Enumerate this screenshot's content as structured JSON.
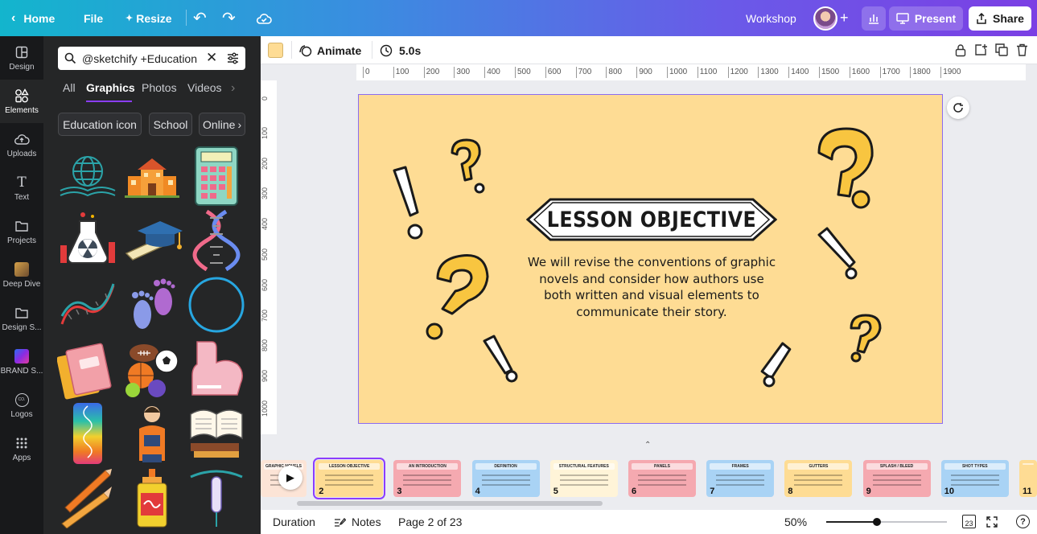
{
  "topbar": {
    "home_label": "Home",
    "file_label": "File",
    "resize_label": "Resize",
    "title": "Workshop",
    "present_label": "Present",
    "share_label": "Share"
  },
  "rail": {
    "items": [
      {
        "label": "Design",
        "icon": "layout-icon"
      },
      {
        "label": "Elements",
        "icon": "shapes-icon"
      },
      {
        "label": "Uploads",
        "icon": "cloud-upload-icon"
      },
      {
        "label": "Text",
        "icon": "text-icon"
      },
      {
        "label": "Projects",
        "icon": "folder-icon"
      },
      {
        "label": "Deep Dive",
        "icon": "app-thumbnail-icon"
      },
      {
        "label": "Design S...",
        "icon": "folder-icon"
      },
      {
        "label": "BRAND S...",
        "icon": "brand-gradient-icon"
      },
      {
        "label": "Logos",
        "icon": "logo-badge-icon"
      },
      {
        "label": "Apps",
        "icon": "apps-grid-icon"
      }
    ]
  },
  "panel": {
    "search_value": "@sketchify +Education",
    "tabs": [
      "All",
      "Graphics",
      "Photos",
      "Videos"
    ],
    "active_tab": "Graphics",
    "chips": [
      "Education icon",
      "School",
      "Online"
    ]
  },
  "toolbar": {
    "color": "#fedc94",
    "animate_label": "Animate",
    "duration_label": "5.0s"
  },
  "rulers": {
    "h": [
      "0",
      "100",
      "200",
      "300",
      "400",
      "500",
      "600",
      "700",
      "800",
      "900",
      "1000",
      "1100",
      "1200",
      "1300",
      "1400",
      "1500",
      "1600",
      "1700",
      "1800",
      "1900"
    ],
    "v": [
      "0",
      "100",
      "200",
      "300",
      "400",
      "500",
      "600",
      "700",
      "800",
      "900",
      "1000"
    ]
  },
  "slide": {
    "background": "#fedc94",
    "title": "LESSON OBJECTIVE",
    "body_lines": [
      "We will revise the conventions of graphic",
      "novels and consider how authors use",
      "both written and visual elements to",
      "communicate their story."
    ]
  },
  "filmstrip": {
    "pages": [
      {
        "n": "",
        "label": "GRAPHIC NOVELS",
        "color": "#fce4d6"
      },
      {
        "n": "2",
        "label": "LESSON OBJECTIVE",
        "color": "#fedc94"
      },
      {
        "n": "3",
        "label": "AN INTRODUCTION",
        "color": "#f5a9b0"
      },
      {
        "n": "4",
        "label": "DEFINITION",
        "color": "#a9d3f5"
      },
      {
        "n": "5",
        "label": "STRUCTURAL FEATURES",
        "color": "#fff4d8"
      },
      {
        "n": "6",
        "label": "PANELS",
        "color": "#f5a9b0"
      },
      {
        "n": "7",
        "label": "FRAMES",
        "color": "#a9d3f5"
      },
      {
        "n": "8",
        "label": "GUTTERS",
        "color": "#fedc94"
      },
      {
        "n": "9",
        "label": "SPLASH / BLEED",
        "color": "#f5a9b0"
      },
      {
        "n": "10",
        "label": "SHOT TYPES",
        "color": "#a9d3f5"
      },
      {
        "n": "11",
        "label": "",
        "color": "#fedc94"
      }
    ]
  },
  "bottom": {
    "duration_label": "Duration",
    "notes_label": "Notes",
    "page_label": "Page 2 of 23",
    "zoom_label": "50%",
    "page_count": "23",
    "zoom_fraction": 0.42
  },
  "colors": {
    "accent": "#8b3dff",
    "panel_bg": "#252627",
    "rail_bg": "#18191b"
  }
}
